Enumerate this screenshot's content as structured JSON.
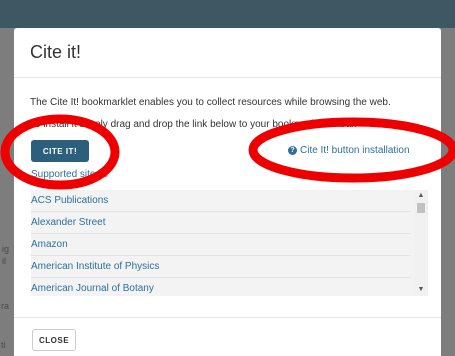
{
  "modal": {
    "title": "Cite it!",
    "description": "The Cite It! bookmarklet enables you to collect resources while browsing the web.",
    "instructions": "To install it simply drag and drop the link below to your bookmarks toolbar.",
    "cite_button_label": "CITE IT!",
    "install_link_label": "Cite It! button installation",
    "supported_sites_label": "Supported sites",
    "sites": [
      "ACS Publications",
      "Alexander Street",
      "Amazon",
      "American Institute of Physics",
      "American Journal of Botany"
    ],
    "close_button_label": "CLOSE"
  },
  "background": {
    "fragments": [
      "ig",
      "il",
      "ra",
      "ti"
    ]
  },
  "colors": {
    "top_bar": "#3f5763",
    "primary_button": "#2c5f7c",
    "link": "#2f6f9a",
    "annotation": "#ee0000"
  },
  "icons": {
    "question": "question-circle-icon",
    "chevron": "chevron-down-icon"
  }
}
